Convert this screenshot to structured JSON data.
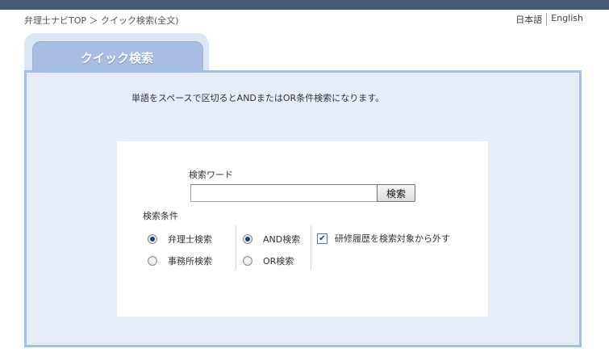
{
  "breadcrumb": {
    "home": "弁理士ナビTOP",
    "separator": "＞",
    "current": "クイック検索(全文)"
  },
  "lang": {
    "japanese": "日本語",
    "english": "English"
  },
  "tab": {
    "label": "クイック検索"
  },
  "hint": "単語をスペースで区切るとANDまたはOR条件検索になります。",
  "search": {
    "word_label": "検索ワード",
    "value": "",
    "button": "検索"
  },
  "conditions": {
    "label": "検索条件",
    "target": [
      {
        "label": "弁理士検索",
        "selected": true
      },
      {
        "label": "事務所検索",
        "selected": false
      }
    ],
    "logic": [
      {
        "label": "AND検索",
        "selected": true
      },
      {
        "label": "OR検索",
        "selected": false
      }
    ],
    "exclude_history": {
      "label": "研修履歴を検索対象から外す",
      "checked": true
    }
  }
}
